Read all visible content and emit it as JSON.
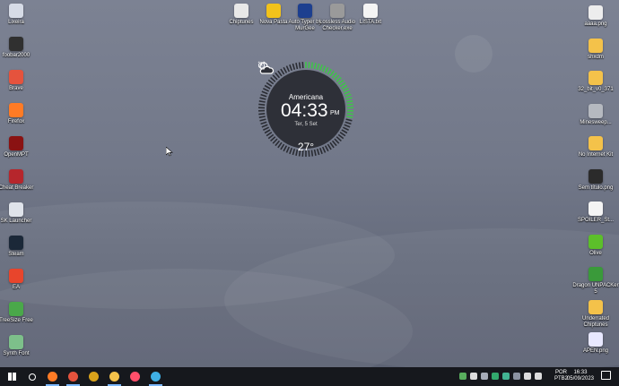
{
  "desktop": {
    "left_icons": [
      {
        "label": "Lixeira",
        "icon": "recycle-bin-icon",
        "color": "#d6dbe6"
      },
      {
        "label": "foobar2000",
        "icon": "foobar-icon",
        "color": "#303030"
      },
      {
        "label": "Brave",
        "icon": "brave-icon",
        "color": "#e5533d"
      },
      {
        "label": "Firefox",
        "icon": "firefox-icon",
        "color": "#ff7b25"
      },
      {
        "label": "OpenMPT",
        "icon": "openmpt-icon",
        "color": "#8a1212"
      },
      {
        "label": "Cheat Breaker",
        "icon": "cheat-breaker-icon",
        "color": "#b6262c"
      },
      {
        "label": "SK Launcher",
        "icon": "sk-launcher-icon",
        "color": "#dfe3ea"
      },
      {
        "label": "Steam",
        "icon": "steam-icon",
        "color": "#1b2838"
      },
      {
        "label": "EA",
        "icon": "ea-icon",
        "color": "#e8452c"
      },
      {
        "label": "TreeSize Free",
        "icon": "treesize-icon",
        "color": "#4aa84a"
      },
      {
        "label": "Synth Font",
        "icon": "synth-font-icon",
        "color": "#7dc08a"
      }
    ],
    "top_icons": [
      {
        "label": "Chiptunes",
        "icon": "chiptunes-icon",
        "color": "#e8e8e8"
      },
      {
        "label": "Nova Pasta",
        "icon": "star-icon",
        "color": "#f2c21b"
      },
      {
        "label": "Auto Typer by MurGee",
        "icon": "auto-typer-icon",
        "color": "#1d3f8f"
      },
      {
        "label": "Lossless Audio Checker.exe",
        "icon": "lossless-audio-icon",
        "color": "#9a9a9a"
      },
      {
        "label": "LISTA.txt",
        "icon": "text-file-icon",
        "color": "#f4f4f4"
      }
    ],
    "right_icons": [
      {
        "label": "aaaa.png",
        "icon": "image-file-icon",
        "color": "#ededed"
      },
      {
        "label": "shxdm",
        "icon": "folder-icon",
        "color": "#f4c24a"
      },
      {
        "label": "32_bit_v0_371",
        "icon": "folder-icon",
        "color": "#f4c24a"
      },
      {
        "label": "Minesweep...",
        "icon": "minesweeper-icon",
        "color": "#b5b9c0"
      },
      {
        "label": "No Internet Kit",
        "icon": "folder-icon",
        "color": "#f4c24a"
      },
      {
        "label": "Sem título.png",
        "icon": "image-file-icon",
        "color": "#2b2b2b"
      },
      {
        "label": "SPOILER_St...",
        "icon": "document-icon",
        "color": "#f4f4f4"
      },
      {
        "label": "Olive",
        "icon": "olive-icon",
        "color": "#5cbf2a"
      },
      {
        "label": "Dragon UNPACKer 5",
        "icon": "dragon-unpacker-icon",
        "color": "#3a9a3a"
      },
      {
        "label": "Underrated Chiptunes",
        "icon": "folder-icon",
        "color": "#f4c24a"
      },
      {
        "label": "APEN.png",
        "icon": "image-file-icon",
        "color": "#e8e8ff"
      }
    ]
  },
  "clock_widget": {
    "city": "Americana",
    "time": "04:33",
    "ampm": "PM",
    "date": "Ter, 5 Set",
    "temperature": "27°",
    "weather_icon": "partly-cloudy-icon",
    "alarm_icon": "alarm-clock-icon",
    "progress": 0.28,
    "accent": "#3fc34a"
  },
  "taskbar": {
    "apps": [
      {
        "name": "windows-start-icon",
        "color": "#3a8bff",
        "active": false
      },
      {
        "name": "search-icon",
        "color": "#ffffff",
        "active": false
      },
      {
        "name": "firefox-taskbar-icon",
        "color": "#ff7b25",
        "active": true
      },
      {
        "name": "brave-taskbar-icon",
        "color": "#e5533d",
        "active": true
      },
      {
        "name": "app-yellow-icon",
        "color": "#d9a21b",
        "active": false
      },
      {
        "name": "file-explorer-icon",
        "color": "#f4c24a",
        "active": true
      },
      {
        "name": "app-multicolor-icon",
        "color": "#ff4f6a",
        "active": false
      },
      {
        "name": "app-people-icon",
        "color": "#3fb0e6",
        "active": true
      }
    ],
    "tray_icons": [
      {
        "name": "tray-minesweeper-icon",
        "color": "#64c86a"
      },
      {
        "name": "tray-network-icon",
        "color": "#ffffff"
      },
      {
        "name": "tray-drop-icon",
        "color": "#bfc6d4"
      },
      {
        "name": "tray-green-icon",
        "color": "#37c27b"
      },
      {
        "name": "tray-box-icon",
        "color": "#4ad0a8"
      },
      {
        "name": "tray-gear-icon",
        "color": "#a0a8b8"
      },
      {
        "name": "tray-speaker-icon",
        "color": "#ffffff"
      },
      {
        "name": "tray-volume-icon",
        "color": "#ffffff"
      }
    ],
    "lang_top": "POR",
    "lang_bottom": "PTB2",
    "clock_time": "16:33",
    "clock_date": "05/09/2023"
  }
}
